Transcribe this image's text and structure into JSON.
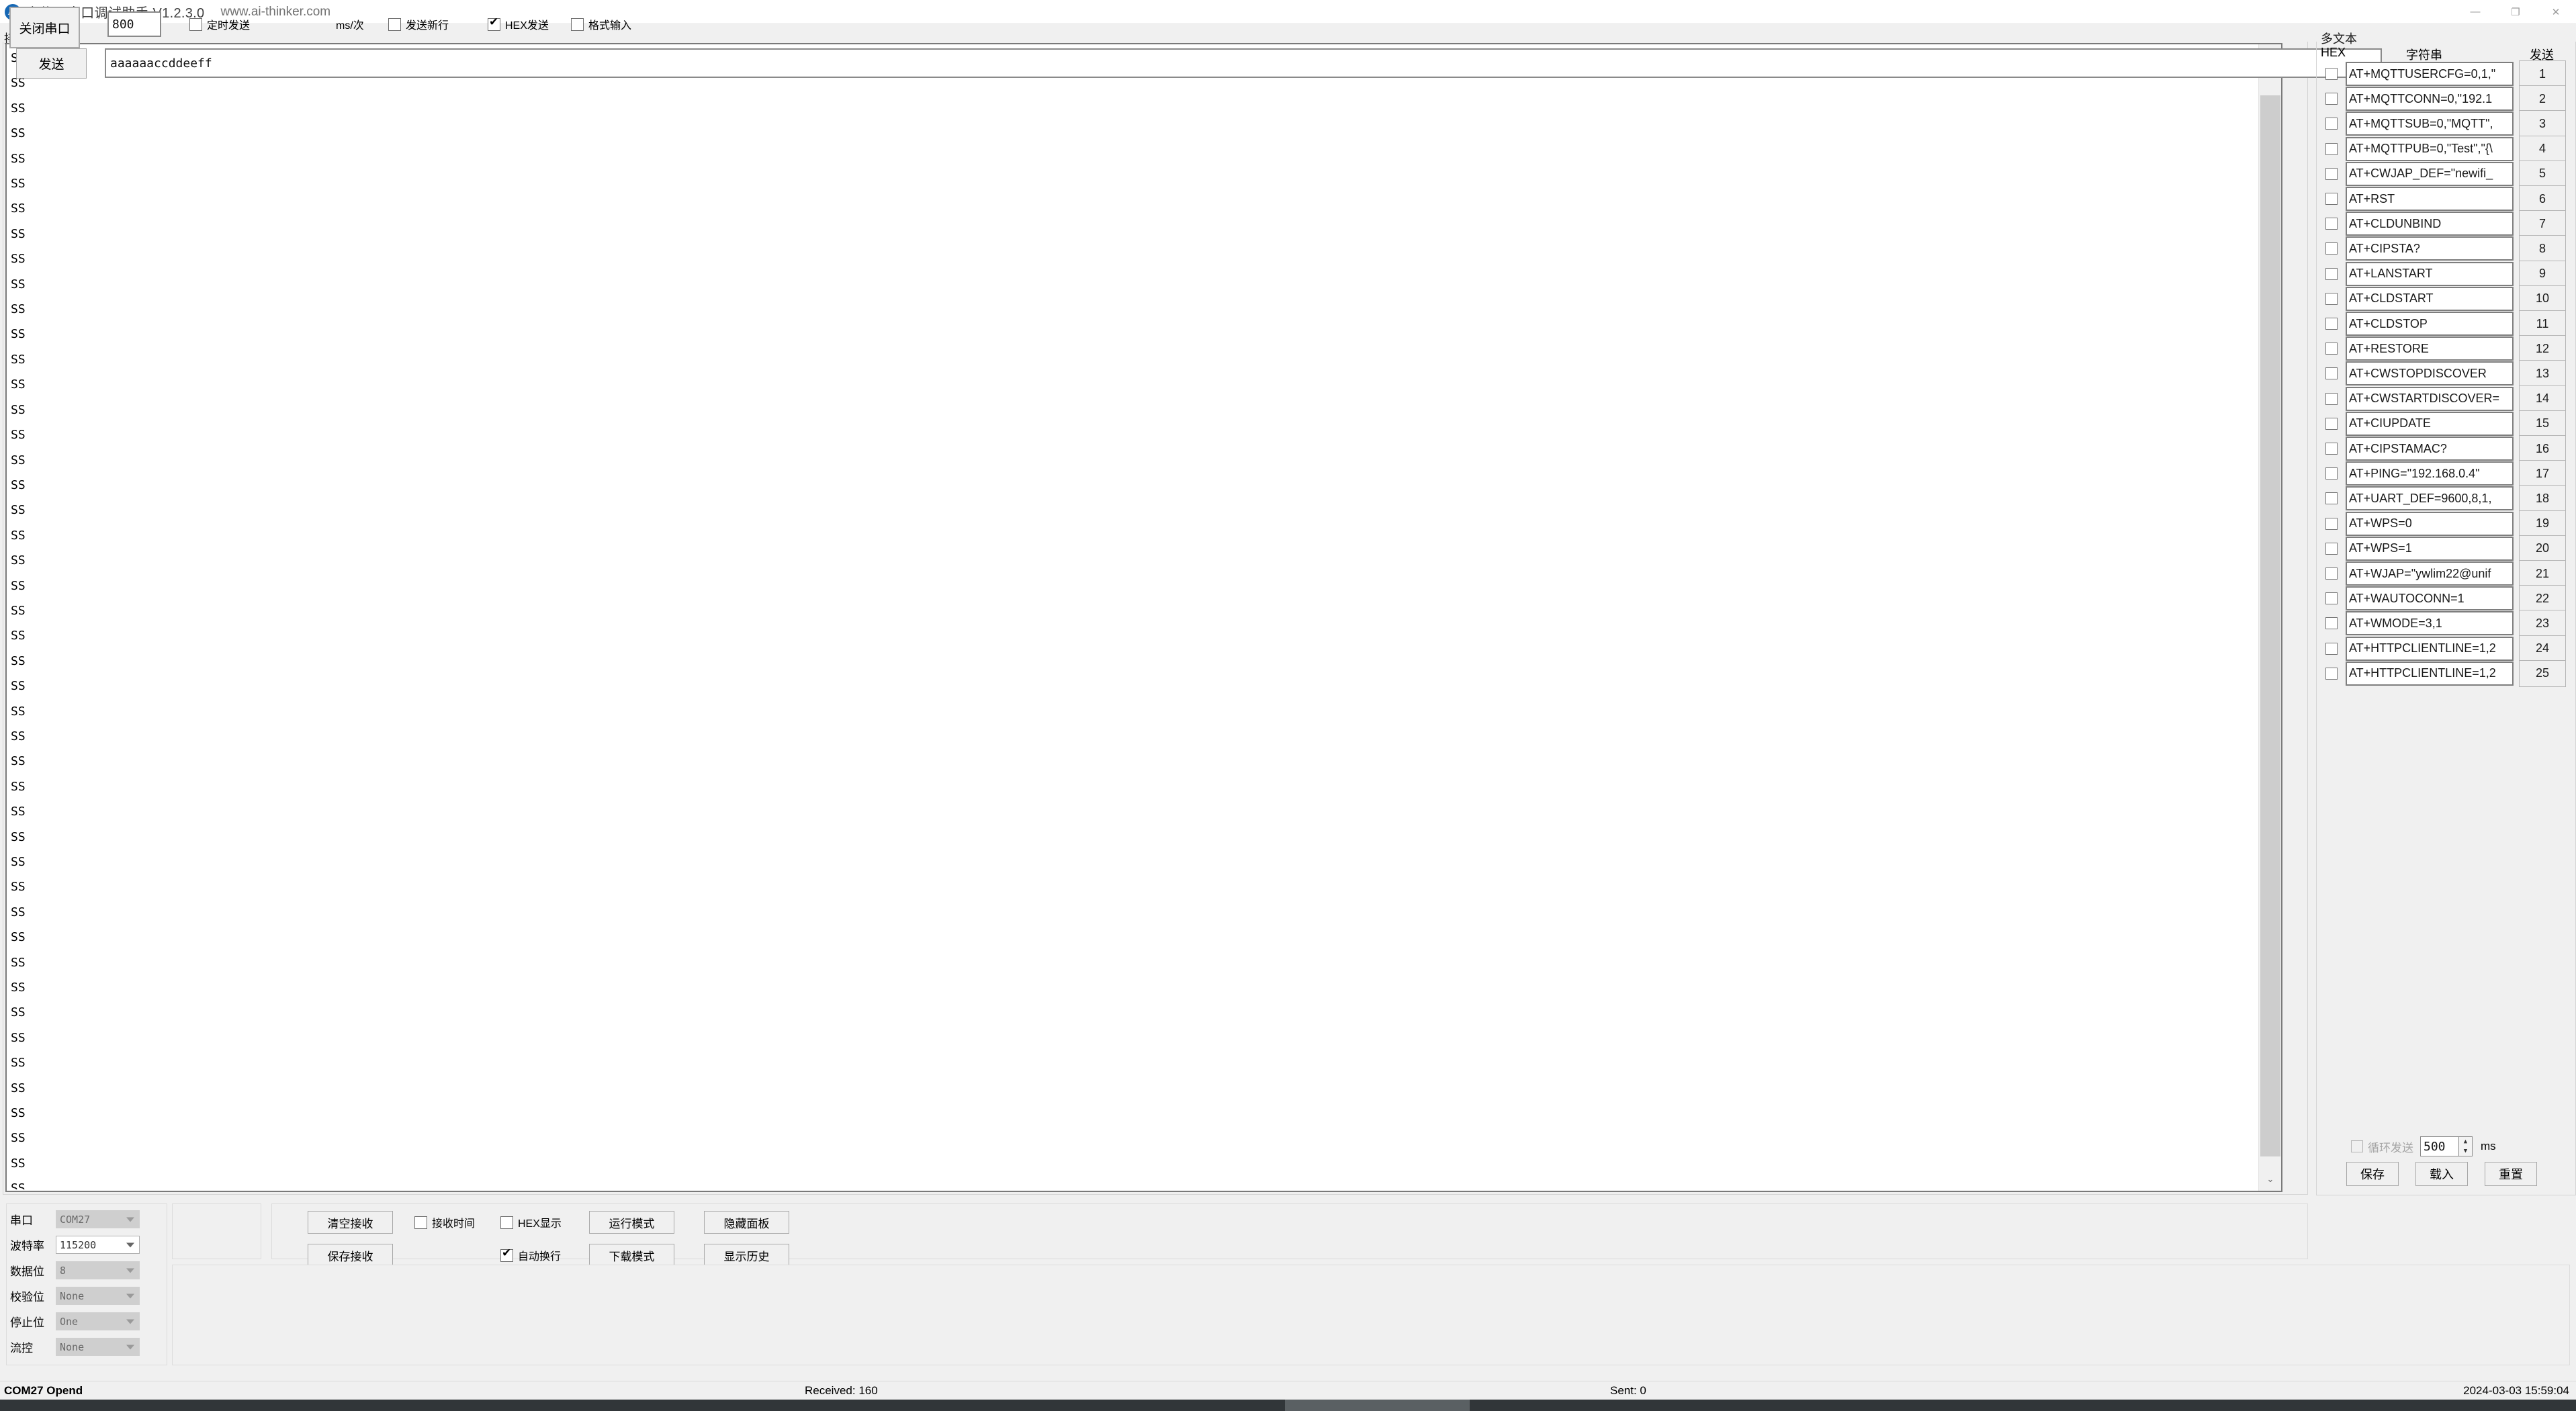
{
  "window": {
    "title": "安信可串口调试助手 V1.2.3.0",
    "url": "www.ai-thinker.com",
    "logo_text": "AI",
    "minimize": "—",
    "maximize": "❐",
    "close": "✕"
  },
  "receive": {
    "group_label": "接收",
    "content": "SS\nSS\nSS\nSS\nSS\nSS\nSS\nSS\nSS\nSS\nSS\nSS\nSS\nSS\nSS\nSS\nSS\nSS\nSS\nSS\nSS\nSS\nSS\nSS\nSS\nSS\nSS\nSS\nSS\nSS\nSS\nSS\nSS\nSS\nSS\nSS\nSS\nSS\nSS\nSS\nSS\nSS\nSS\nSS\nSS\nSS",
    "scroll_up": "⌃",
    "scroll_down": "⌄"
  },
  "port_settings": {
    "rows": [
      {
        "label": "串口",
        "value": "COM27",
        "enabled": false
      },
      {
        "label": "波特率",
        "value": "115200",
        "enabled": true
      },
      {
        "label": "数据位",
        "value": "8",
        "enabled": false
      },
      {
        "label": "校验位",
        "value": "None",
        "enabled": false
      },
      {
        "label": "停止位",
        "value": "One",
        "enabled": false
      },
      {
        "label": "流控",
        "value": "None",
        "enabled": false
      }
    ]
  },
  "port_button": {
    "label": "关闭串口"
  },
  "recv_toolbar": {
    "clear_recv": "清空接收",
    "save_recv": "保存接收",
    "recv_time_label": "接收时间",
    "recv_time_checked": false,
    "hex_display_label": "HEX显示",
    "hex_display_checked": false,
    "auto_newline_label": "自动换行",
    "auto_newline_checked": true,
    "run_mode": "运行模式",
    "download_mode": "下载模式",
    "hide_panel": "隐藏面板",
    "show_history": "显示历史"
  },
  "send": {
    "timed_send_label": "定时发送",
    "timed_send_checked": false,
    "interval_value": "800",
    "interval_unit": "ms/次",
    "send_newline_label": "发送新行",
    "send_newline_checked": false,
    "hex_send_label": "HEX发送",
    "hex_send_checked": true,
    "format_input_label": "格式输入",
    "format_input_checked": false,
    "send_button": "发送",
    "input_value": "aaaaaaccddeeff"
  },
  "multitext": {
    "group_label": "多文本",
    "header_hex": "HEX",
    "header_string": "字符串",
    "header_send": "发送",
    "rows": [
      {
        "n": "1",
        "cmd": "AT+MQTTUSERCFG=0,1,\""
      },
      {
        "n": "2",
        "cmd": "AT+MQTTCONN=0,\"192.1"
      },
      {
        "n": "3",
        "cmd": "AT+MQTTSUB=0,\"MQTT\","
      },
      {
        "n": "4",
        "cmd": "AT+MQTTPUB=0,\"Test\",\"{\\"
      },
      {
        "n": "5",
        "cmd": "AT+CWJAP_DEF=\"newifi_"
      },
      {
        "n": "6",
        "cmd": "AT+RST"
      },
      {
        "n": "7",
        "cmd": "AT+CLDUNBIND"
      },
      {
        "n": "8",
        "cmd": "AT+CIPSTA?"
      },
      {
        "n": "9",
        "cmd": "AT+LANSTART"
      },
      {
        "n": "10",
        "cmd": "AT+CLDSTART"
      },
      {
        "n": "11",
        "cmd": "AT+CLDSTOP"
      },
      {
        "n": "12",
        "cmd": "AT+RESTORE"
      },
      {
        "n": "13",
        "cmd": "AT+CWSTOPDISCOVER"
      },
      {
        "n": "14",
        "cmd": "AT+CWSTARTDISCOVER="
      },
      {
        "n": "15",
        "cmd": "AT+CIUPDATE"
      },
      {
        "n": "16",
        "cmd": "AT+CIPSTAMAC?"
      },
      {
        "n": "17",
        "cmd": "AT+PING=\"192.168.0.4\""
      },
      {
        "n": "18",
        "cmd": "AT+UART_DEF=9600,8,1,"
      },
      {
        "n": "19",
        "cmd": "AT+WPS=0"
      },
      {
        "n": "20",
        "cmd": "AT+WPS=1"
      },
      {
        "n": "21",
        "cmd": "AT+WJAP=\"ywlim22@unif"
      },
      {
        "n": "22",
        "cmd": "AT+WAUTOCONN=1"
      },
      {
        "n": "23",
        "cmd": "AT+WMODE=3,1"
      },
      {
        "n": "24",
        "cmd": "AT+HTTPCLIENTLINE=1,2"
      },
      {
        "n": "25",
        "cmd": "AT+HTTPCLIENTLINE=1,2"
      }
    ],
    "loop_send_label": "循环发送",
    "loop_send_checked": false,
    "loop_ms_value": "500",
    "loop_ms_unit": "ms",
    "save": "保存",
    "load": "载入",
    "reset": "重置"
  },
  "statusbar": {
    "port_state": "COM27 Opend",
    "received": "Received: 160",
    "sent": "Sent: 0",
    "datetime": "2024-03-03 15:59:04"
  }
}
